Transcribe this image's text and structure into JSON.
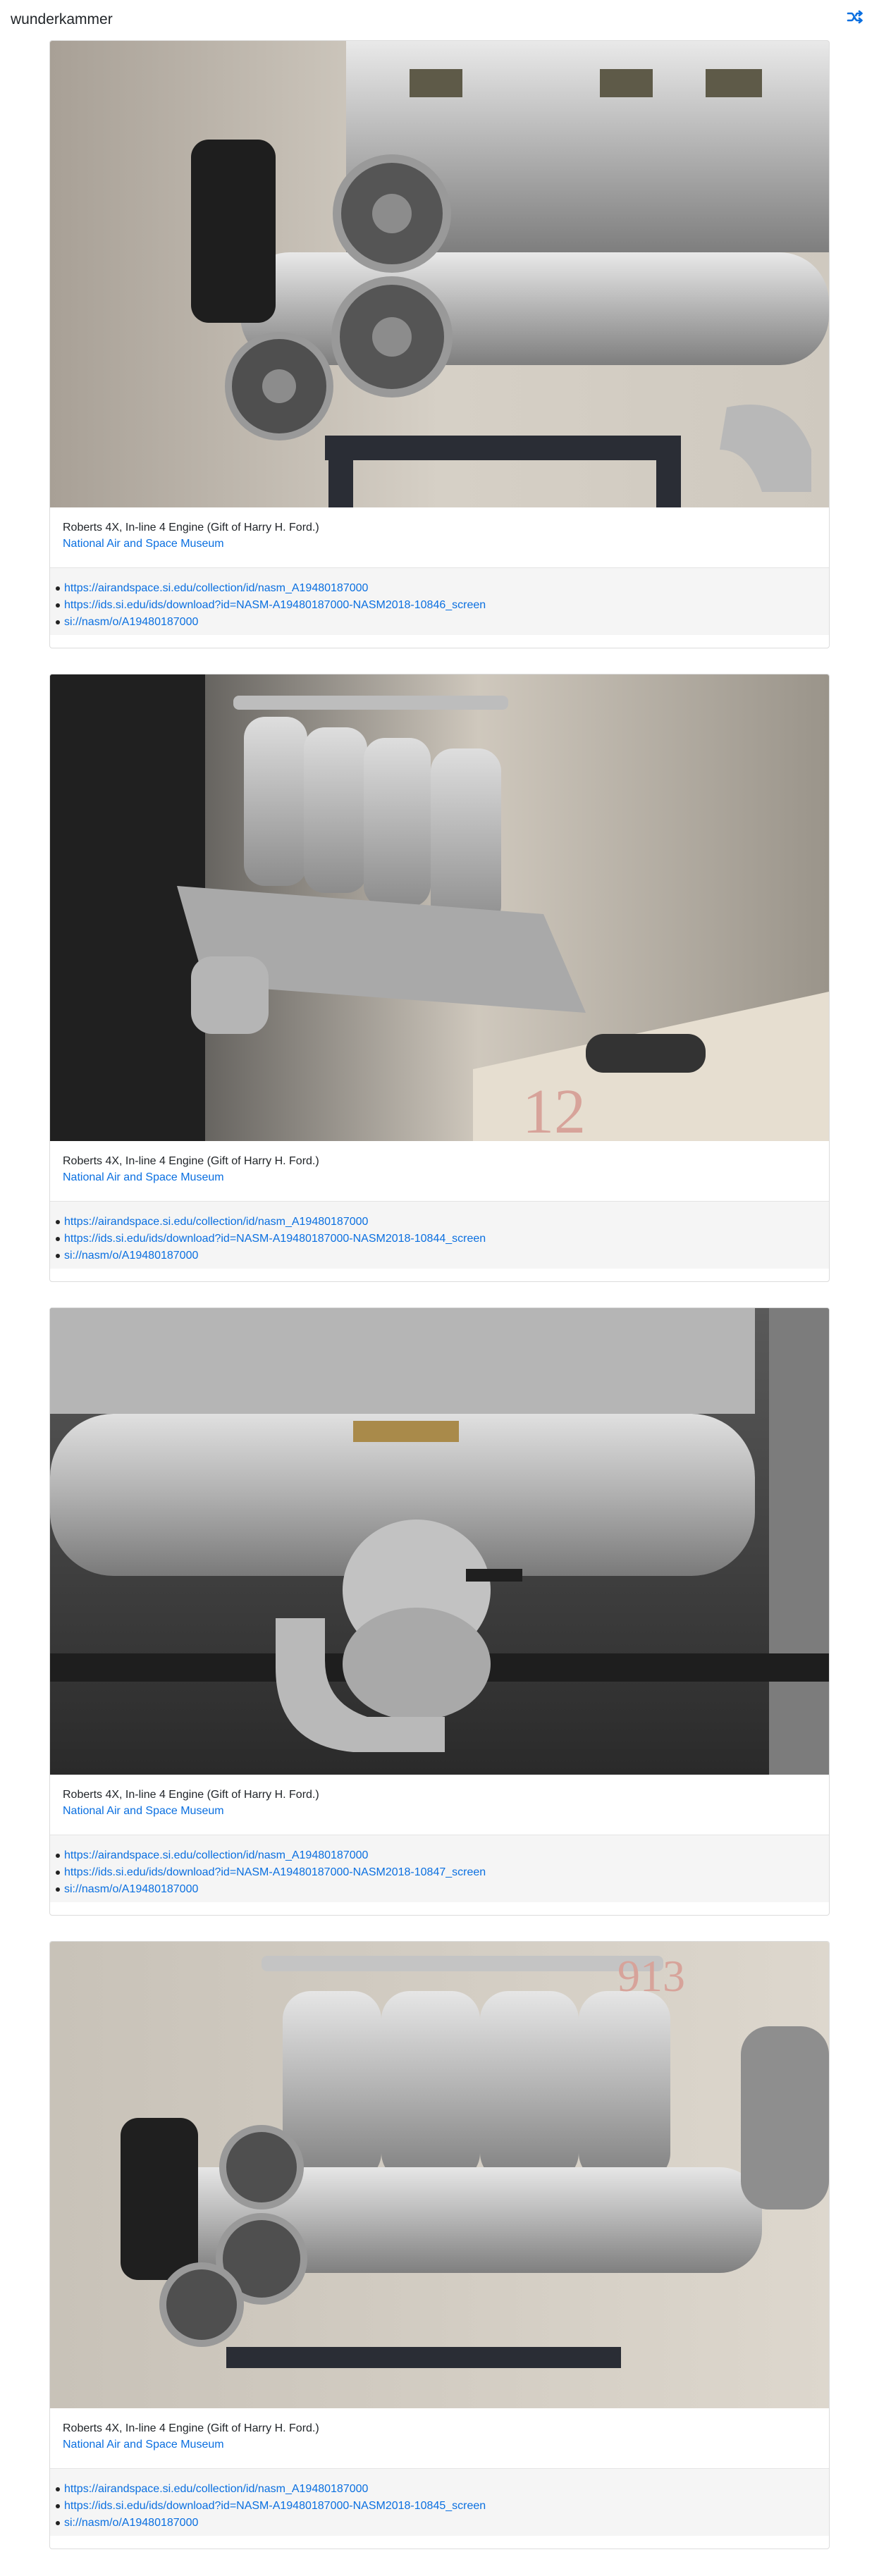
{
  "header": {
    "brand": "wunderkammer",
    "shuffle_icon": "shuffle-icon"
  },
  "colors": {
    "link": "#0a6fe0",
    "text": "#212529",
    "footer_bg": "#f5f5f5",
    "border": "#dcdcdc"
  },
  "cards": [
    {
      "caption": "Roberts 4X, In-line 4 Engine (Gift of Harry H. Ford.)",
      "museum": "National Air and Space Museum",
      "links": [
        "https://airandspace.si.edu/collection/id/nasm_A19480187000",
        "https://ids.si.edu/ids/download?id=NASM-A19480187000-NASM2018-10846_screen",
        "si://nasm/o/A19480187000"
      ]
    },
    {
      "caption": "Roberts 4X, In-line 4 Engine (Gift of Harry H. Ford.)",
      "museum": "National Air and Space Museum",
      "links": [
        "https://airandspace.si.edu/collection/id/nasm_A19480187000",
        "https://ids.si.edu/ids/download?id=NASM-A19480187000-NASM2018-10844_screen",
        "si://nasm/o/A19480187000"
      ]
    },
    {
      "caption": "Roberts 4X, In-line 4 Engine (Gift of Harry H. Ford.)",
      "museum": "National Air and Space Museum",
      "links": [
        "https://airandspace.si.edu/collection/id/nasm_A19480187000",
        "https://ids.si.edu/ids/download?id=NASM-A19480187000-NASM2018-10847_screen",
        "si://nasm/o/A19480187000"
      ]
    },
    {
      "caption": "Roberts 4X, In-line 4 Engine (Gift of Harry H. Ford.)",
      "museum": "National Air and Space Museum",
      "links": [
        "https://airandspace.si.edu/collection/id/nasm_A19480187000",
        "https://ids.si.edu/ids/download?id=NASM-A19480187000-NASM2018-10845_screen",
        "si://nasm/o/A19480187000"
      ]
    }
  ]
}
